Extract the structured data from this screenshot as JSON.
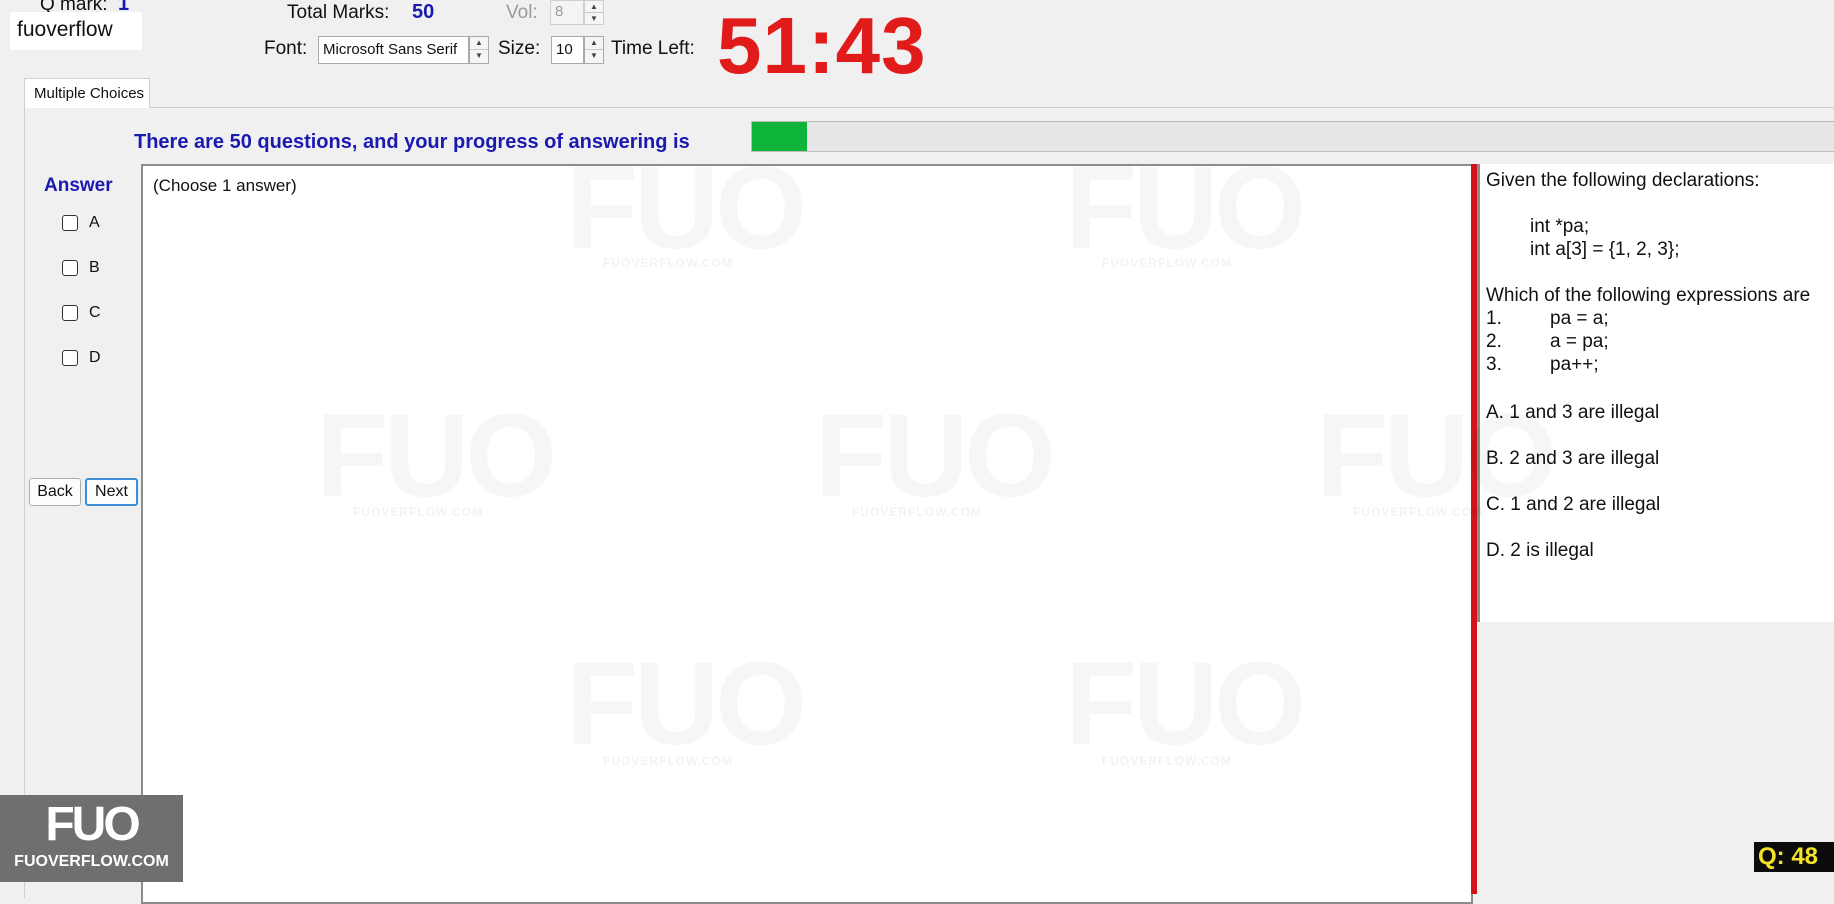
{
  "header": {
    "qmark_label": "Q mark:",
    "qmark_value": "1",
    "total_marks_label": "Total Marks:",
    "total_marks_value": "50",
    "vol_label": "Vol:",
    "vol_value": "8",
    "font_label": "Font:",
    "font_value": "Microsoft Sans Serif",
    "size_label": "Size:",
    "size_value": "10",
    "time_left_label": "Time Left:",
    "timer": "51:43"
  },
  "brand_text": "fuoverflow",
  "tabs": [
    {
      "label": "Multiple Choices"
    }
  ],
  "progress": {
    "label": "There are 50 questions, and your progress of answering is",
    "fraction": 0.05,
    "color": "#0fb43a"
  },
  "answer": {
    "title": "Answer",
    "options": [
      "A",
      "B",
      "C",
      "D"
    ],
    "back_label": "Back",
    "next_label": "Next",
    "hint": "(Choose 1 answer)"
  },
  "question": {
    "lines": [
      "Given the following declarations:",
      "int *pa;",
      "int a[3] = {1, 2, 3};",
      "Which of the following expressions are",
      "1.",
      "pa = a;",
      "2.",
      "a = pa;",
      "3.",
      "pa++;",
      "A.  1 and 3 are illegal",
      "B.  2 and 3 are illegal",
      "C.  1 and 2 are illegal",
      "D.  2 is illegal"
    ]
  },
  "watermark": {
    "logo": "FUO",
    "url": "FUOVERFLOW.COM"
  },
  "logo": {
    "big": "FUO",
    "small": "FUOVERFLOW.COM"
  },
  "qbadge": "Q:  48",
  "colors": {
    "accent_blue": "#1a1ab0",
    "timer_red": "#e11a1a",
    "split_red": "#d1141c"
  }
}
